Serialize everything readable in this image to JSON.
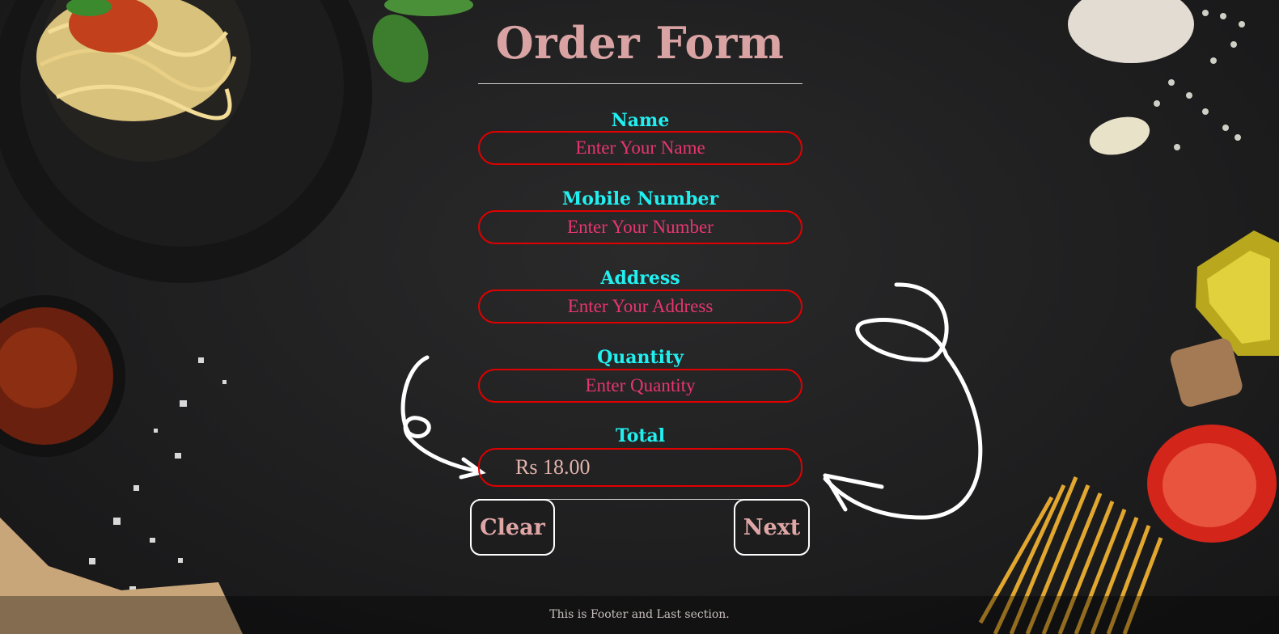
{
  "form": {
    "title": "Order Form",
    "fields": [
      {
        "label": "Name",
        "placeholder": "Enter Your Name",
        "value": ""
      },
      {
        "label": "Mobile Number",
        "placeholder": "Enter Your Number",
        "value": ""
      },
      {
        "label": "Address",
        "placeholder": "Enter Your Address",
        "value": ""
      },
      {
        "label": "Quantity",
        "placeholder": "Enter Quantity",
        "value": ""
      }
    ],
    "total": {
      "label": "Total",
      "value": "Rs 18.00"
    },
    "buttons": {
      "clear": "Clear",
      "next": "Next"
    }
  },
  "footer": {
    "text": "This is Footer and Last section."
  },
  "colors": {
    "title": "#d9a3a3",
    "label": "#22f0f0",
    "input_border": "#e00000",
    "placeholder": "#e8356f",
    "background": "#1b1b1c"
  },
  "decorations": [
    "spaghetti-plate",
    "basil-leaves",
    "garlic",
    "pepper-corns",
    "olive-oil-bottle",
    "cork",
    "tomato-half",
    "dry-pasta",
    "sauce-bowl",
    "salt-crystals",
    "hand-drawn-arrows"
  ]
}
